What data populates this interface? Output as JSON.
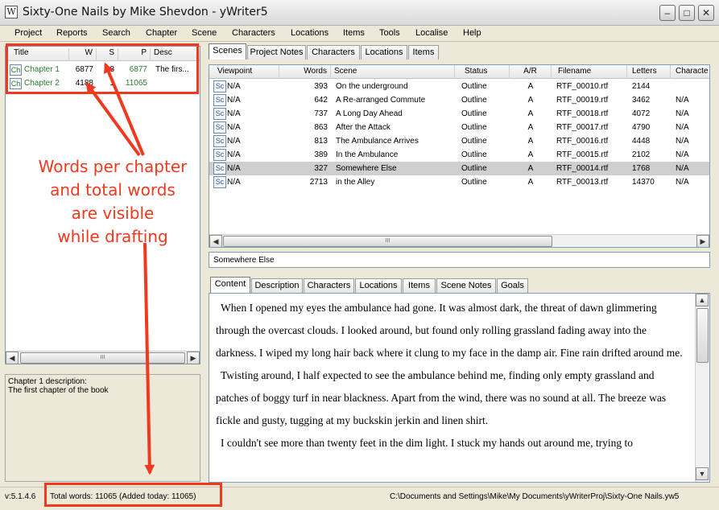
{
  "window": {
    "title": "Sixty-One Nails by Mike Shevdon - yWriter5",
    "app_icon": "W"
  },
  "menu": [
    "Project",
    "Reports",
    "Search",
    "Chapter",
    "Scene",
    "Characters",
    "Locations",
    "Items",
    "Tools",
    "Localise",
    "Help"
  ],
  "chapters": {
    "headers": [
      "Title",
      "W",
      "S",
      "P",
      "Desc"
    ],
    "rows": [
      {
        "icon": "Ch",
        "title": "Chapter 1",
        "w": "6877",
        "s": "8",
        "p": "6877",
        "desc": "The firs..."
      },
      {
        "icon": "Ch",
        "title": "Chapter 2",
        "w": "4188",
        "s": "1",
        "p": "11065",
        "desc": ""
      }
    ],
    "scroll_glyph": "III"
  },
  "chapter_description": {
    "line1": "Chapter 1 description:",
    "line2": "The first chapter of the book"
  },
  "top_tabs": [
    "Scenes",
    "Project Notes",
    "Characters",
    "Locations",
    "Items"
  ],
  "scenes": {
    "headers": [
      "Viewpoint",
      "Words",
      "Scene",
      "Status",
      "A/R",
      "Filename",
      "Letters",
      "Characte"
    ],
    "rows": [
      {
        "icon": "Sc",
        "viewpoint": "N/A",
        "words": "393",
        "scene": "On the underground",
        "status": "Outline",
        "ar": "A",
        "filename": "RTF_00010.rtf",
        "letters": "2144",
        "characters": ""
      },
      {
        "icon": "Sc",
        "viewpoint": "N/A",
        "words": "642",
        "scene": "A Re-arranged Commute",
        "status": "Outline",
        "ar": "A",
        "filename": "RTF_00019.rtf",
        "letters": "3462",
        "characters": "N/A"
      },
      {
        "icon": "Sc",
        "viewpoint": "N/A",
        "words": "737",
        "scene": "A Long Day Ahead",
        "status": "Outline",
        "ar": "A",
        "filename": "RTF_00018.rtf",
        "letters": "4072",
        "characters": "N/A"
      },
      {
        "icon": "Sc",
        "viewpoint": "N/A",
        "words": "863",
        "scene": "After the Attack",
        "status": "Outline",
        "ar": "A",
        "filename": "RTF_00017.rtf",
        "letters": "4790",
        "characters": "N/A"
      },
      {
        "icon": "Sc",
        "viewpoint": "N/A",
        "words": "813",
        "scene": "The Ambulance Arrives",
        "status": "Outline",
        "ar": "A",
        "filename": "RTF_00016.rtf",
        "letters": "4448",
        "characters": "N/A"
      },
      {
        "icon": "Sc",
        "viewpoint": "N/A",
        "words": "389",
        "scene": "In the Ambulance",
        "status": "Outline",
        "ar": "A",
        "filename": "RTF_00015.rtf",
        "letters": "2102",
        "characters": "N/A"
      },
      {
        "icon": "Sc",
        "viewpoint": "N/A",
        "words": "327",
        "scene": "Somewhere Else",
        "status": "Outline",
        "ar": "A",
        "filename": "RTF_00014.rtf",
        "letters": "1768",
        "characters": "N/A",
        "selected": true
      },
      {
        "icon": "Sc",
        "viewpoint": "N/A",
        "words": "2713",
        "scene": "in the Alley",
        "status": "Outline",
        "ar": "A",
        "filename": "RTF_00013.rtf",
        "letters": "14370",
        "characters": "N/A"
      }
    ]
  },
  "scene_title": "Somewhere Else",
  "editor_tabs": [
    "Content",
    "Description",
    "Characters",
    "Locations",
    "Items",
    "Scene Notes",
    "Goals"
  ],
  "content_text": "When I opened my eyes the ambulance had gone.  It was almost dark, the threat of dawn glimmering through the overcast clouds.  I looked around, but found only rolling grassland fading away into the darkness.  I wiped my long hair back where it clung to my face in the damp air.  Fine rain drifted around me.\n Twisting around, I half expected to see the ambulance behind me, finding only empty grassland and patches of boggy turf in near blackness.   Apart from the wind, there was no sound at all.  The breeze was fickle and gusty, tugging at my buckskin jerkin and linen shirt.\n I couldn't see more than twenty feet in the dim light.  I stuck my hands out around me, trying to",
  "status": {
    "version": "v:5.1.4.6",
    "total_words": "Total words: 11065 (Added today: 11065)",
    "path": "C:\\Documents and Settings\\Mike\\My Documents\\yWriterProj\\Sixty-One Nails.yw5"
  },
  "annotation": {
    "line1": "Words per chapter",
    "line2": "and total words",
    "line3": "are visible",
    "line4": "while drafting"
  },
  "colors": {
    "annotation_red": "#f0391e",
    "chapter_green": "#2b7a2b",
    "selected_row": "#cfcfcf"
  }
}
